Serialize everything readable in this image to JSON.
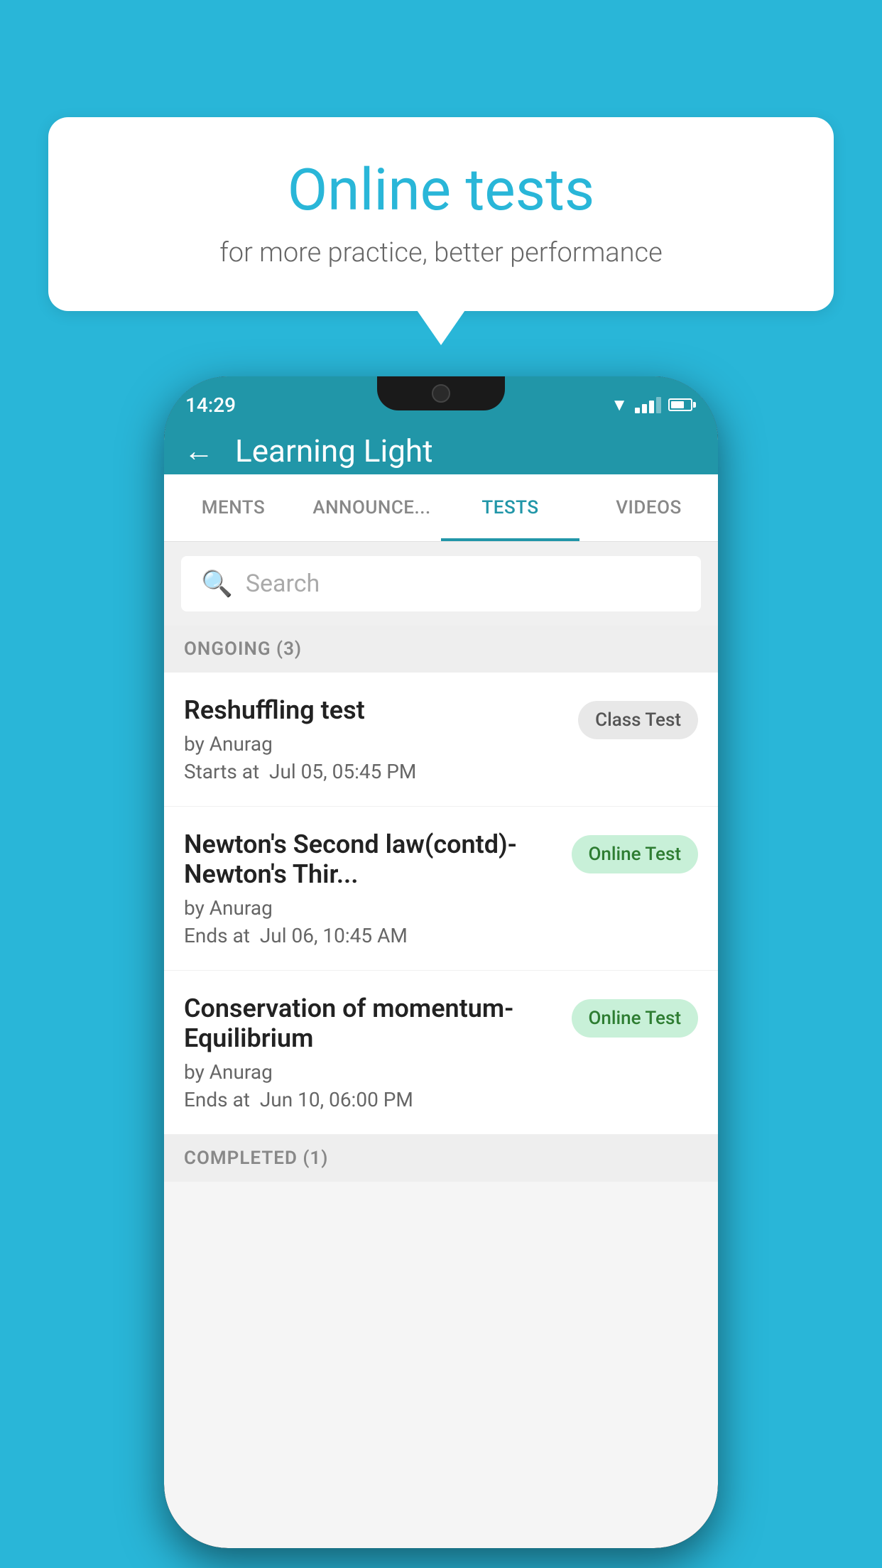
{
  "background": {
    "color": "#29b6d8"
  },
  "speech_bubble": {
    "title": "Online tests",
    "subtitle": "for more practice, better performance"
  },
  "status_bar": {
    "time": "14:29"
  },
  "app_bar": {
    "title": "Learning Light",
    "back_label": "←"
  },
  "tabs": [
    {
      "label": "MENTS",
      "active": false
    },
    {
      "label": "ANNOUNCEMENTS",
      "active": false
    },
    {
      "label": "TESTS",
      "active": true
    },
    {
      "label": "VIDEOS",
      "active": false
    }
  ],
  "search": {
    "placeholder": "Search"
  },
  "sections": [
    {
      "header": "ONGOING (3)",
      "items": [
        {
          "name": "Reshuffling test",
          "author": "by Anurag",
          "time_label": "Starts at",
          "time_value": "Jul 05, 05:45 PM",
          "badge": "Class Test",
          "badge_type": "class"
        },
        {
          "name": "Newton's Second law(contd)-Newton's Thir...",
          "author": "by Anurag",
          "time_label": "Ends at",
          "time_value": "Jul 06, 10:45 AM",
          "badge": "Online Test",
          "badge_type": "online"
        },
        {
          "name": "Conservation of momentum-Equilibrium",
          "author": "by Anurag",
          "time_label": "Ends at",
          "time_value": "Jun 10, 06:00 PM",
          "badge": "Online Test",
          "badge_type": "online"
        }
      ]
    },
    {
      "header": "COMPLETED (1)",
      "items": []
    }
  ]
}
